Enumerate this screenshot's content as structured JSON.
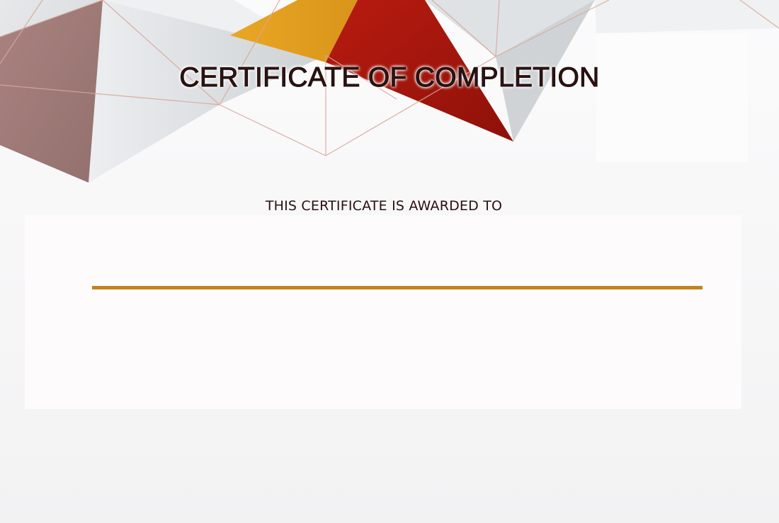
{
  "certificate": {
    "title": "CERTIFICATE OF COMPLETION",
    "subtitle": "THIS CERTIFICATE IS AWARDED TO"
  },
  "colors": {
    "accent_line": "#c3811f",
    "text": "#2a100e",
    "mauve": "#a27a76",
    "gold": "#e1a21f",
    "red": "#a9190f",
    "grey": "#dcdfe2"
  }
}
